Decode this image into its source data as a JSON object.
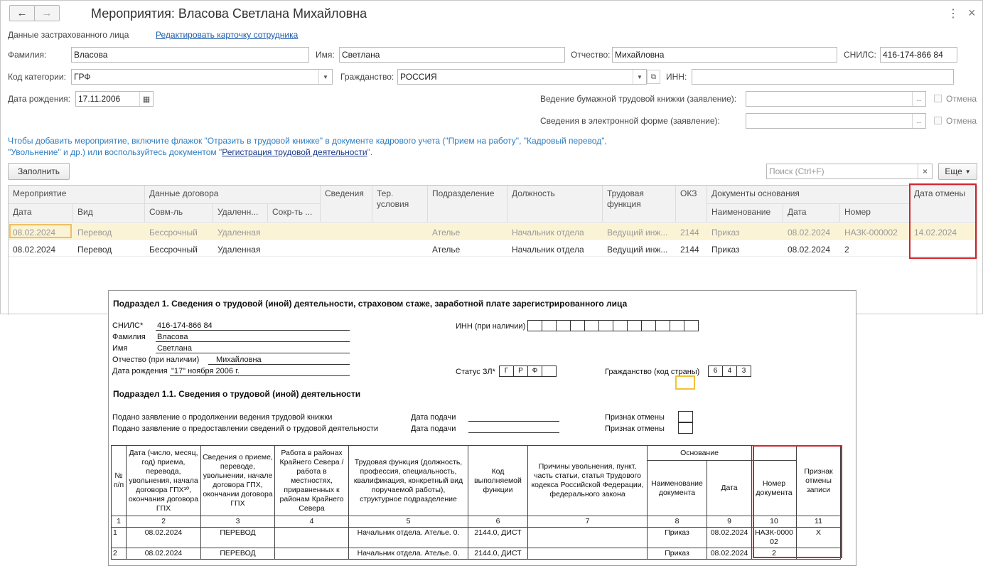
{
  "window": {
    "title": "Мероприятия: Власова Светлана Михайловна",
    "more_icon": "⋮",
    "close_icon": "×"
  },
  "person": {
    "section_label": "Данные застрахованного лица",
    "edit_link": "Редактировать карточку сотрудника",
    "surname_label": "Фамилия:",
    "surname": "Власова",
    "name_label": "Имя:",
    "name": "Светлана",
    "patronymic_label": "Отчество:",
    "patronymic": "Михайловна",
    "snils_label": "СНИЛС:",
    "snils": "416-174-866 84",
    "category_label": "Код категории:",
    "category": "ГРФ",
    "citizenship_label": "Гражданство:",
    "citizenship": "РОССИЯ",
    "inn_label": "ИНН:",
    "inn": "",
    "birth_label": "Дата рождения:",
    "birth_date": "17.11.2006",
    "paper_book_label": "Ведение бумажной трудовой книжки (заявление):",
    "electronic_label": "Сведения в электронной форме (заявление):",
    "cancel_label": "Отмена",
    "ellipsis": "..."
  },
  "info": {
    "text_1": "Чтобы добавить мероприятие, включите флажок \"Отразить в трудовой книжке\" в документе кадрового учета (\"Прием на работу\", \"Кадровый перевод\", \"Увольнение\" и др.) или воспользуйтесь документом \"",
    "link": "Регистрация трудовой деятельности",
    "text_2": "\"."
  },
  "toolbar": {
    "fill_button": "Заполнить",
    "search_placeholder": "Поиск (Ctrl+F)",
    "more_button": "Еще"
  },
  "grid": {
    "headers": {
      "event": "Мероприятие",
      "contract": "Данные договора",
      "info": "Сведения",
      "ter": "Тер. условия",
      "dept": "Подразделение",
      "position": "Должность",
      "labor_func": "Трудовая функция",
      "okz": "ОКЗ",
      "docs": "Документы основания",
      "cancel_date": "Дата отмены",
      "date": "Дата",
      "type": "Вид",
      "combo": "Совм-ль",
      "remote": "Удаленн...",
      "short": "Сокр-ть ...",
      "doc_name": "Наименование",
      "doc_date": "Дата",
      "doc_num": "Номер"
    },
    "rows": [
      {
        "date": "08.02.2024",
        "type": "Перевод",
        "combo": "Бессрочный",
        "remote": "Удаленная",
        "dept": "Ателье",
        "position": "Начальник отдела",
        "func": "Ведущий инж...",
        "okz": "2144",
        "doc_name": "Приказ",
        "doc_date": "08.02.2024",
        "doc_num": "НАЗК-000002",
        "cancel": "14.02.2024"
      },
      {
        "date": "08.02.2024",
        "type": "Перевод",
        "combo": "Бессрочный",
        "remote": "Удаленная",
        "dept": "Ателье",
        "position": "Начальник отдела",
        "func": "Ведущий инж...",
        "okz": "2144",
        "doc_name": "Приказ",
        "doc_date": "08.02.2024",
        "doc_num": "2",
        "cancel": ""
      }
    ]
  },
  "form": {
    "section_title": "Подраздел 1. Сведения о трудовой (иной) деятельности, страховом стаже, заработной плате зарегистрированного лица",
    "snils_label": "СНИЛС*",
    "snils": "416-174-866 84",
    "surname_label": "Фамилия",
    "surname": "Власова",
    "name_label": "Имя",
    "name": "Светлана",
    "patronymic_label": "Отчество (при наличии)",
    "patronymic": "Михайловна",
    "birth_label": "Дата рождения",
    "birth": "\"17\" ноября 2006 г.",
    "inn_label": "ИНН (при наличии)",
    "status_label": "Статус ЗЛ*",
    "status_codes": [
      "Г",
      "Р",
      "Ф"
    ],
    "citizenship_label": "Гражданство (код страны)",
    "citizenship_codes": [
      "6",
      "4",
      "3"
    ],
    "subsection_title": "Подраздел 1.1. Сведения о трудовой (иной) деятельности",
    "continue_label": "Подано заявление о продолжении ведения трудовой книжки",
    "provide_label": "Подано заявление о предоставлении сведений о трудовой деятельности",
    "submit_date_label": "Дата подачи",
    "cancel_sign_label": "Признак отмены",
    "table": {
      "h_num": "№ п/п",
      "h_date": "Дата (число, месяц, год) приема, перевода, увольнения, начала договора ГПХ¹º, окончания договора ГПХ",
      "h_info": "Сведения о приеме, переводе, увольнении, начале договора ГПХ, окончании договора ГПХ",
      "h_north": "Работа в районах Крайнего Севера / работа в местностях, приравненных к районам Крайнего Севера",
      "h_func": "Трудовая функция (должность, профессия, специальность, квалификация, конкретный вид поручаемой работы), структурное подразделение",
      "h_code": "Код выполняемой функции",
      "h_reason": "Причины увольнения, пункт, часть статьи, статья Трудового кодекса Российской Федерации, федерального закона",
      "h_basis": "Основание",
      "h_doc_name": "Наименование документа",
      "h_doc_date": "Дата",
      "h_doc_num": "Номер документа",
      "h_cancel": "Признак отмены записи",
      "col_nums": [
        "1",
        "2",
        "3",
        "4",
        "5",
        "6",
        "7",
        "8",
        "9",
        "10",
        "11"
      ],
      "rows": [
        {
          "n": "1",
          "date": "08.02.2024",
          "info": "ПЕРЕВОД",
          "north": "",
          "func": "Начальник отдела. Ателье. 0.",
          "code": "2144.0, ДИСТ",
          "reason": "",
          "doc_name": "Приказ",
          "doc_date": "08.02.2024",
          "doc_num": "НАЗК-0000\n02",
          "cancel": "X"
        },
        {
          "n": "2",
          "date": "08.02.2024",
          "info": "ПЕРЕВОД",
          "north": "",
          "func": "Начальник отдела. Ателье. 0.",
          "code": "2144.0, ДИСТ",
          "reason": "",
          "doc_name": "Приказ",
          "doc_date": "08.02.2024",
          "doc_num": "2",
          "cancel": ""
        }
      ]
    }
  },
  "colors": {
    "highlight_red": "#d3262b",
    "row_selected": "#fbf3d6",
    "link": "#1c5cab",
    "info": "#2f7ec1"
  }
}
